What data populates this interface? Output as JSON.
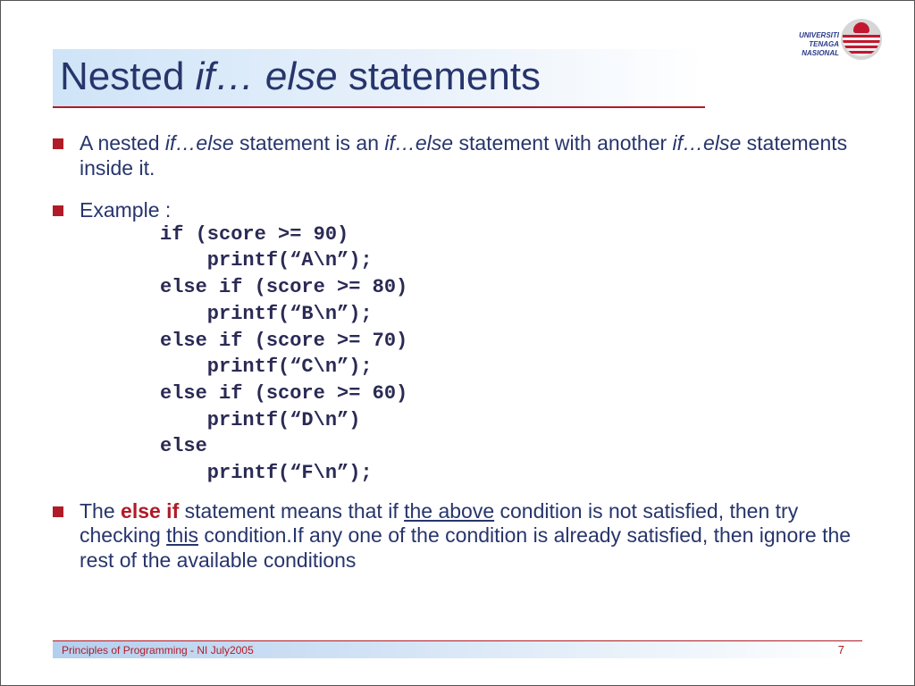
{
  "logo": {
    "line1": "UNIVERSITI",
    "line2": "TENAGA",
    "line3": "NASIONAL"
  },
  "title": {
    "part1": "Nested ",
    "part2_ital": "if… else",
    "part3": " statements"
  },
  "bullets": {
    "b1": {
      "t1": "A nested ",
      "t2_ital": "if…else",
      "t3": " statement is an ",
      "t4_ital": "if…else",
      "t5": " statement with another  ",
      "t6_ital": "if…else",
      "t7": " statements inside it."
    },
    "b2": {
      "label": "Example :"
    },
    "b3": {
      "t1": "The ",
      "t2_red": "else if",
      "t3": " statement means that if ",
      "t4_udl": "the above",
      "t5": " condition is not satisfied, then try checking ",
      "t6_udl": "this",
      "t7": " condition.If any one of the condition is already satisfied, then ignore the rest of the available conditions"
    }
  },
  "code": {
    "l1": "if (score >= 90)",
    "l2": "    printf(“A\\n”);",
    "l3": "else if (score >= 80)",
    "l4": "    printf(“B\\n”);",
    "l5": "else if (score >= 70)",
    "l6": "    printf(“C\\n”);",
    "l7": "else if (score >= 60)",
    "l8": "    printf(“D\\n”)",
    "l9": "else",
    "l10": "    printf(“F\\n”);"
  },
  "footer": {
    "text": "Principles of Programming - NI July2005",
    "page": "7"
  }
}
